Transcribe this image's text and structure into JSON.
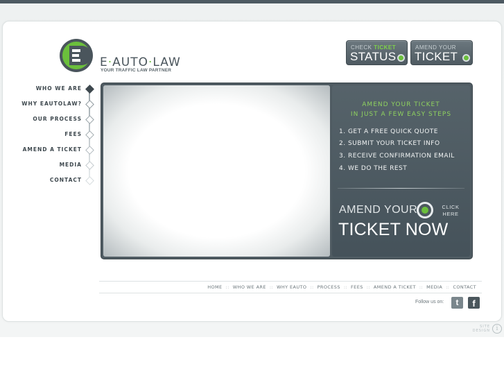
{
  "brand": {
    "name_part1": "E",
    "name_sep": "·",
    "name_part2": "AUTO",
    "name_part3": "LAW",
    "tagline": "YOUR TRAFFIC LAW PARTNER",
    "accent_color": "#6bbf3c",
    "dark_color": "#4f5b62"
  },
  "header_buttons": {
    "status": {
      "small_prefix": "CHECK",
      "small_highlight": "TICKET",
      "big": "STATUS"
    },
    "amend": {
      "small": "AMEND YOUR",
      "big": "TICKET"
    }
  },
  "nav": {
    "items": [
      {
        "label": "WHO WE ARE",
        "active": true
      },
      {
        "label": "WHY EAUTOLAW?",
        "active": false
      },
      {
        "label": "OUR PROCESS",
        "active": false
      },
      {
        "label": "FEES",
        "active": false
      },
      {
        "label": "AMEND A TICKET",
        "active": false
      },
      {
        "label": "MEDIA",
        "active": false
      },
      {
        "label": "CONTACT",
        "active": false
      }
    ]
  },
  "promo": {
    "heading_line1": "AMEND YOUR TICKET",
    "heading_line2": "IN JUST A FEW EASY STEPS",
    "steps": [
      "1. GET A FREE QUICK QUOTE",
      "2. SUBMIT YOUR TICKET INFO",
      "3. RECEIVE CONFIRMATION EMAIL",
      "4. WE DO THE REST"
    ],
    "cta_amend": "AMEND YOUR",
    "cta_click_line1": "CLICK",
    "cta_click_line2": "HERE",
    "cta_ticket": "TICKET NOW"
  },
  "footer": {
    "links": [
      "HOME",
      "WHO WE ARE",
      "WHY EAUTO",
      "PROCESS",
      "FEES",
      "AMEND A TICKET",
      "MEDIA",
      "CONTACT"
    ],
    "separator": "::",
    "follow_label": "Follow us on:",
    "twitter_glyph": "t",
    "facebook_glyph": "f",
    "site_design_line1": "SITE",
    "site_design_line2": "DESIGN",
    "site_design_icon": "i"
  }
}
